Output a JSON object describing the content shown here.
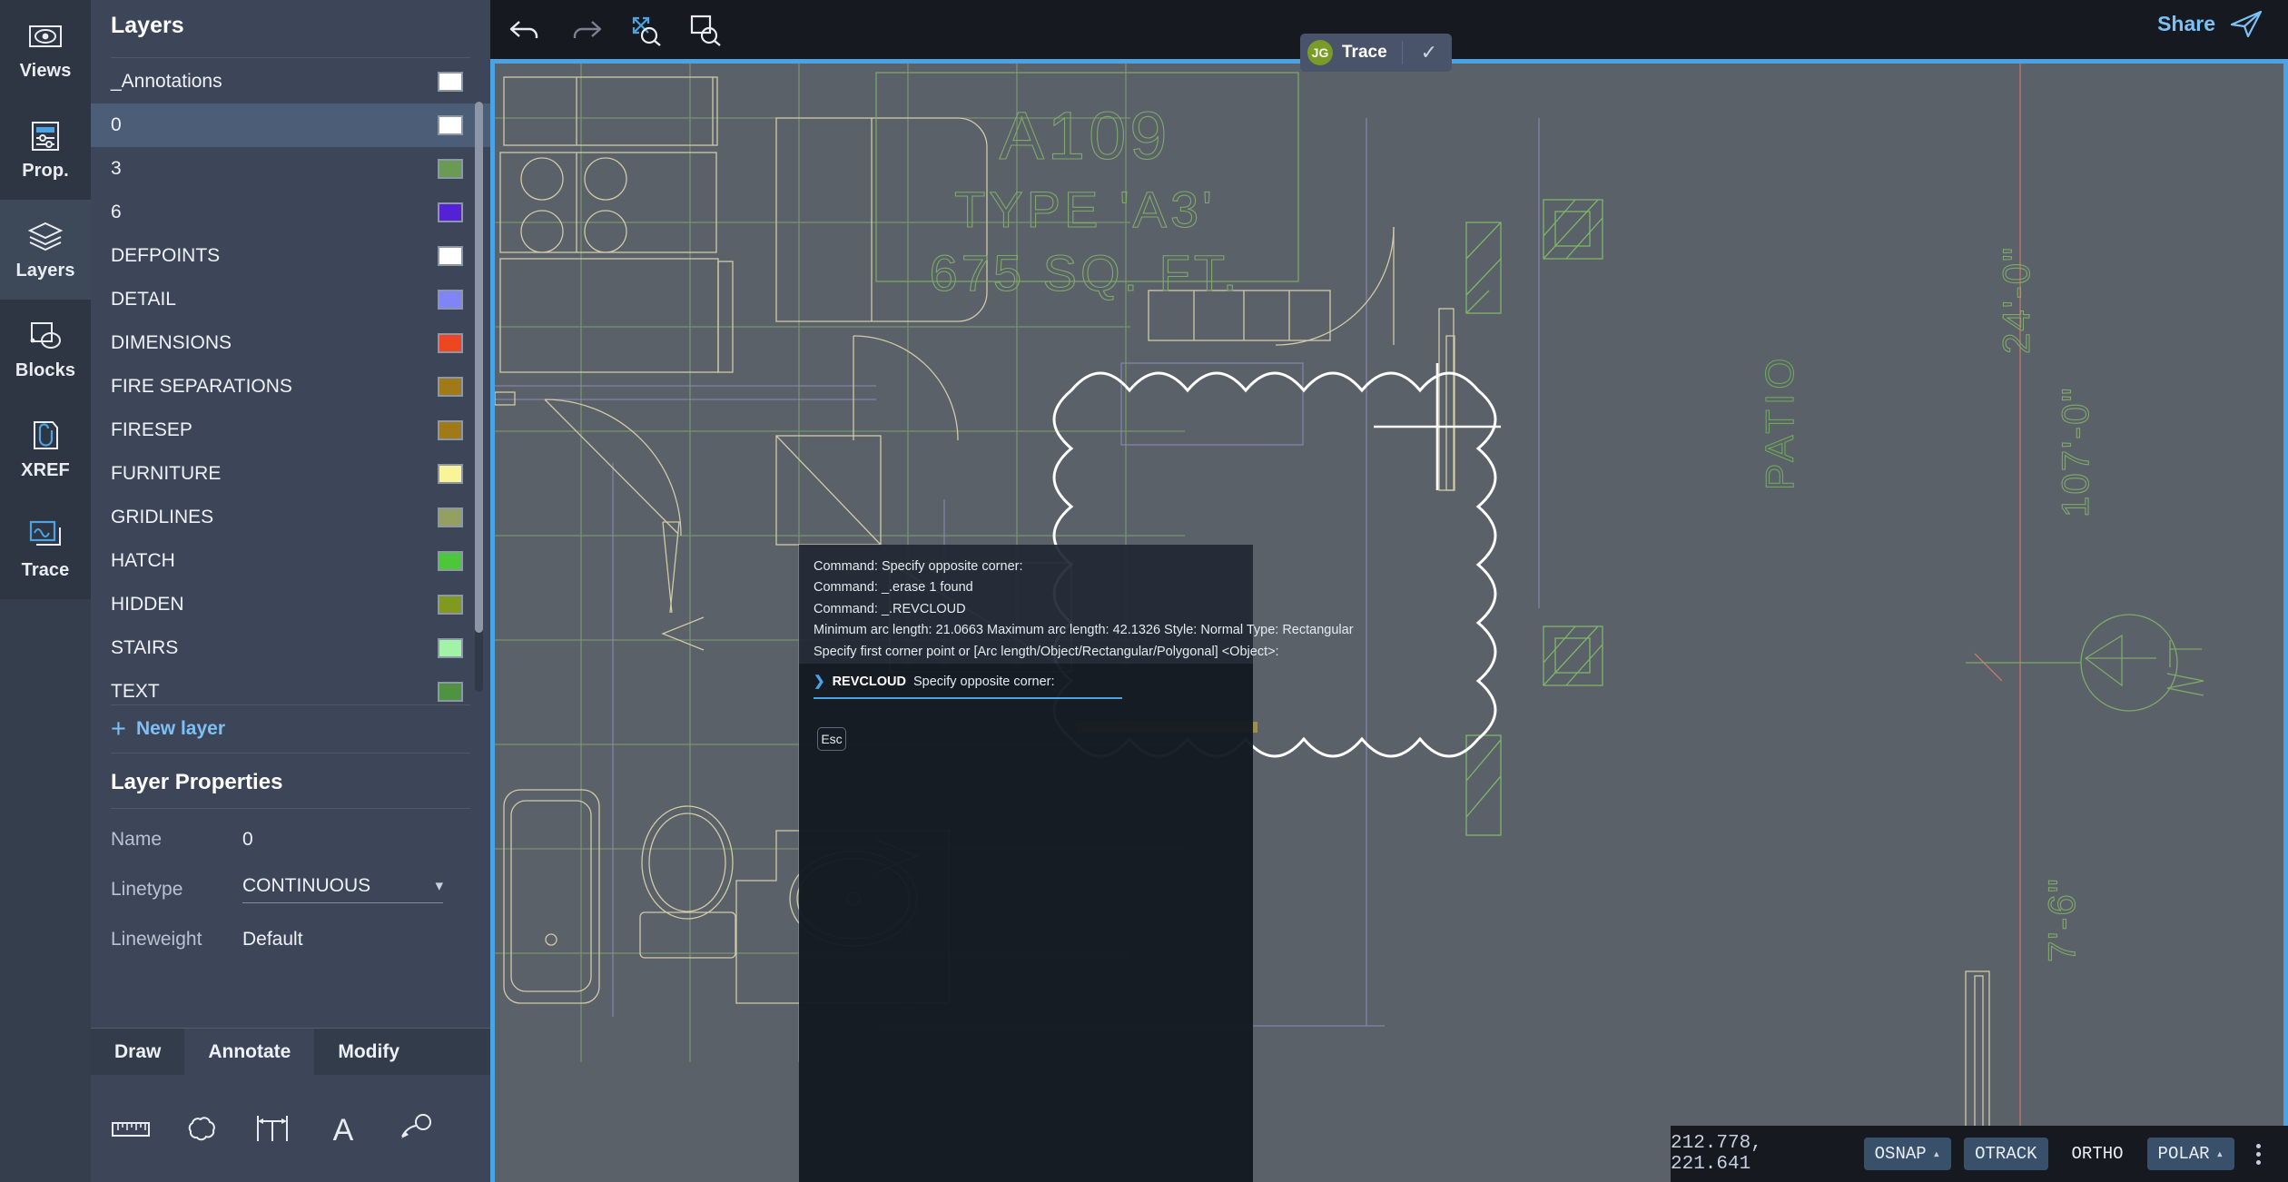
{
  "rail": {
    "items": [
      {
        "label": "Views",
        "icon": "views-icon",
        "active": false
      },
      {
        "label": "Prop.",
        "icon": "properties-icon",
        "active": false
      },
      {
        "label": "Layers",
        "icon": "layers-icon",
        "active": true
      },
      {
        "label": "Blocks",
        "icon": "blocks-icon",
        "active": false
      },
      {
        "label": "XREF",
        "icon": "xref-icon",
        "active": false
      },
      {
        "label": "Trace",
        "icon": "trace-icon",
        "active": false
      }
    ]
  },
  "layers_panel": {
    "title": "Layers",
    "new_layer_label": "New layer",
    "selected_layer": "0",
    "items": [
      {
        "name": "_Annotations",
        "color": "#ffffff"
      },
      {
        "name": "0",
        "color": "#ffffff"
      },
      {
        "name": "3",
        "color": "#6b9a55"
      },
      {
        "name": "6",
        "color": "#5421d4"
      },
      {
        "name": "DEFPOINTS",
        "color": "#ffffff"
      },
      {
        "name": "DETAIL",
        "color": "#7f85f7"
      },
      {
        "name": "DIMENSIONS",
        "color": "#ef4622"
      },
      {
        "name": "FIRE SEPARATIONS",
        "color": "#a07a18"
      },
      {
        "name": "FIRESEP",
        "color": "#a07a18"
      },
      {
        "name": "FURNITURE",
        "color": "#f9f49a"
      },
      {
        "name": "GRIDLINES",
        "color": "#93a062"
      },
      {
        "name": "HATCH",
        "color": "#4cc63b"
      },
      {
        "name": "HIDDEN",
        "color": "#82991f"
      },
      {
        "name": "STAIRS",
        "color": "#a1f3a8"
      },
      {
        "name": "TEXT",
        "color": "#4f9242"
      }
    ]
  },
  "layer_properties": {
    "title": "Layer Properties",
    "rows": [
      {
        "label": "Name",
        "value": "0",
        "type": "text"
      },
      {
        "label": "Linetype",
        "value": "CONTINUOUS",
        "type": "select"
      },
      {
        "label": "Lineweight",
        "value": "Default",
        "type": "text"
      }
    ]
  },
  "ribbon": {
    "tabs": [
      {
        "label": "Draw",
        "active": false
      },
      {
        "label": "Annotate",
        "active": true
      },
      {
        "label": "Modify",
        "active": false
      }
    ],
    "tools": [
      {
        "name": "measure-icon"
      },
      {
        "name": "revision-cloud-icon"
      },
      {
        "name": "dimension-icon"
      },
      {
        "name": "text-icon"
      },
      {
        "name": "leader-icon"
      }
    ]
  },
  "toolbar": {
    "undo_label": "Undo",
    "redo_label": "Redo",
    "zoom_extents_label": "Zoom extents",
    "zoom_window_label": "Zoom window",
    "share_label": "Share"
  },
  "trace": {
    "initials": "JG",
    "name": "Trace",
    "accept_glyph": "✓"
  },
  "console": {
    "history": [
      "Command: Specify opposite corner:",
      "Command: _.erase 1 found",
      "Command: _.REVCLOUD",
      "Minimum arc length: 21.0663 Maximum arc length: 42.1326 Style: Normal Type: Rectangular",
      "Specify first corner point or [Arc length/Object/Rectangular/Polygonal] <Object>:"
    ],
    "prompt_caret": "❯",
    "prompt_command": "REVCLOUD",
    "prompt_text": "Specify opposite corner:",
    "esc_label": "Esc"
  },
  "statusbar": {
    "coordinates": "212.778, 221.641",
    "buttons": [
      {
        "label": "OSNAP",
        "active": true,
        "caret": true
      },
      {
        "label": "OTRACK",
        "active": true,
        "caret": false
      },
      {
        "label": "ORTHO",
        "active": false,
        "caret": false
      },
      {
        "label": "POLAR",
        "active": true,
        "caret": true
      }
    ],
    "menu_icon": "kebab-menu-icon"
  },
  "drawing": {
    "room_tag": "A109",
    "room_type": "TYPE 'A3'",
    "room_area": "675 SQ. FT.",
    "patio_label": "PATIO",
    "dim_vertical_1": "24'-0\"",
    "dim_vertical_2": "107'-0\"",
    "dim_vertical_3": "7'-6\"",
    "colors": {
      "background": "#5b6168",
      "furniture": "#cfcaa8",
      "gridlines": "#8aa57e",
      "text": "#7fa96a",
      "detail": "#8e8ab8",
      "dimensions": "#c4776a",
      "revcloud": "#ffffff",
      "selection": "#4ba3e3"
    }
  }
}
